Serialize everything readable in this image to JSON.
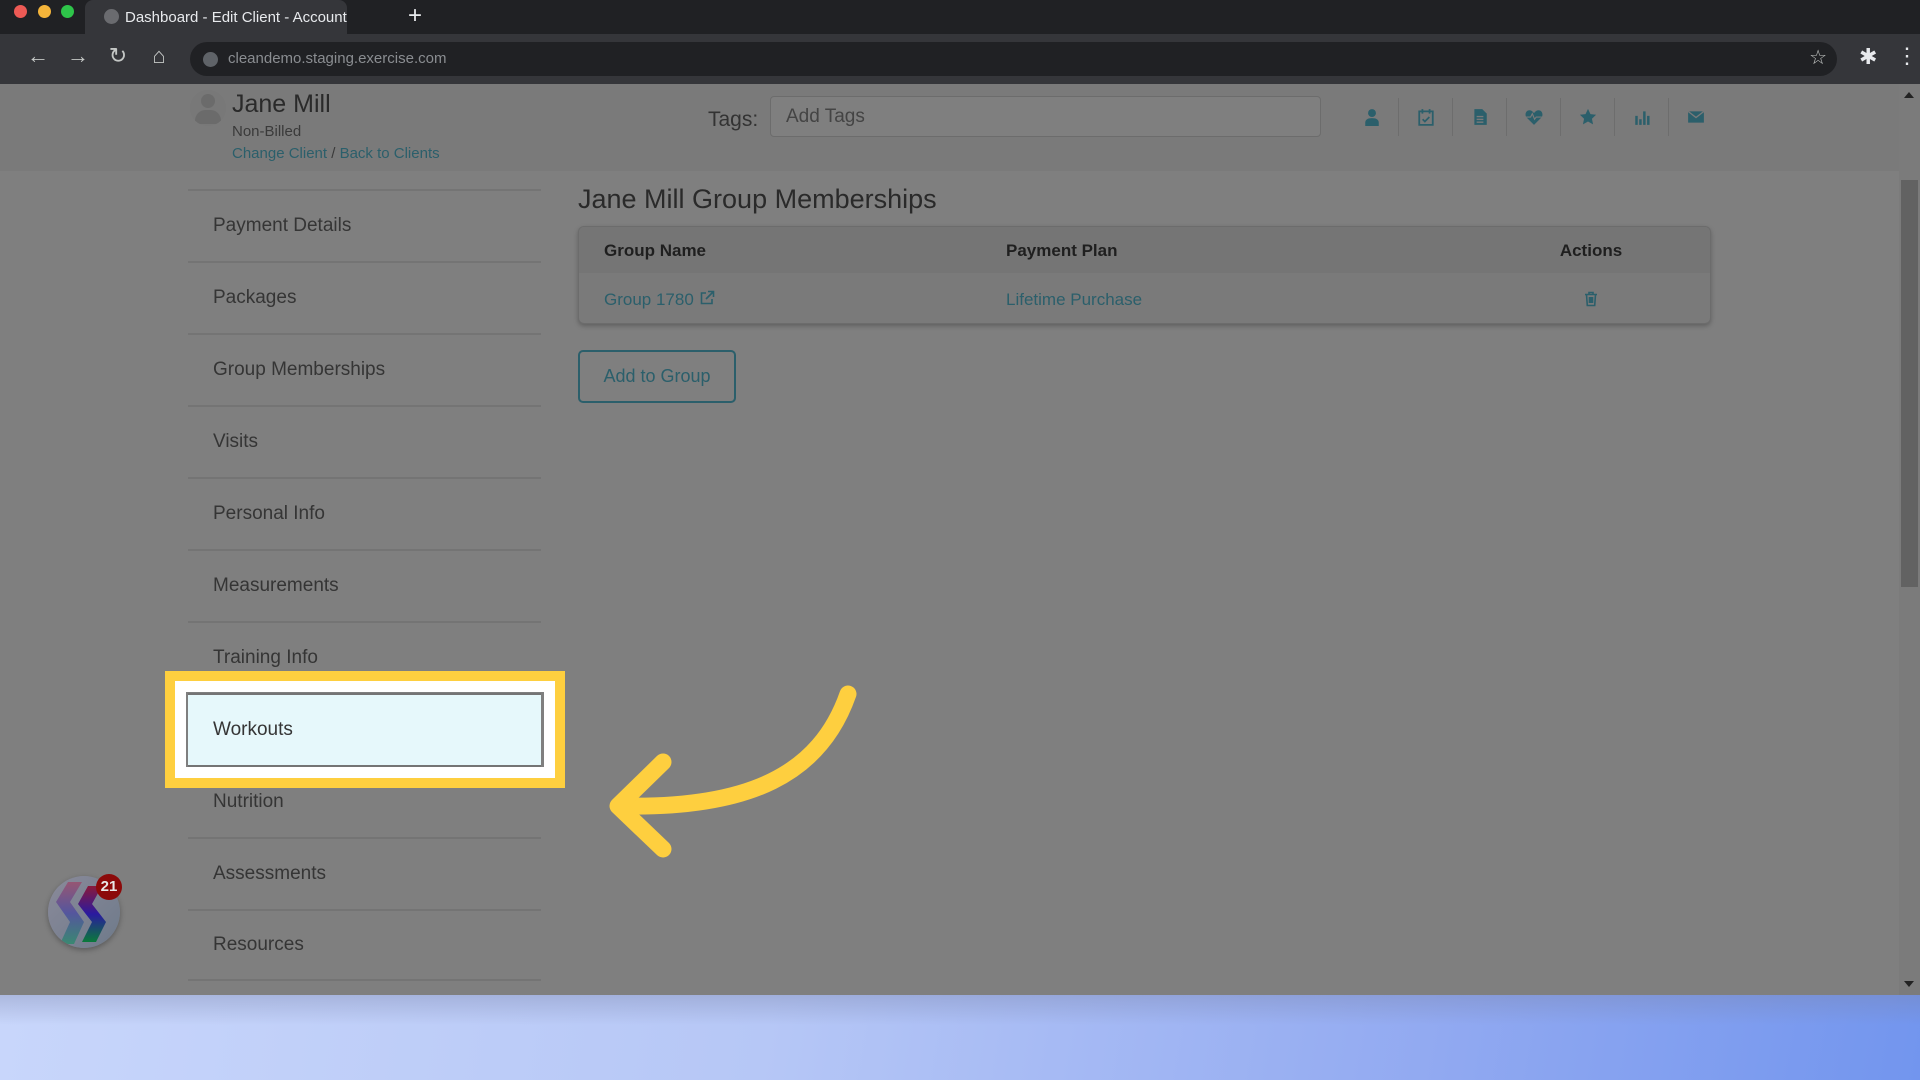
{
  "browser": {
    "tab_title": "Dashboard - Edit Client - Account",
    "new_tab_label": "+",
    "url": "cleandemo.staging.exercise.com"
  },
  "client": {
    "name": "Jane Mill",
    "status": "Non-Billed",
    "change_client_label": "Change Client",
    "separator": "/",
    "back_label": "Back to Clients"
  },
  "tags": {
    "label": "Tags:",
    "placeholder": "Add Tags",
    "value": ""
  },
  "toolbar_icons": [
    "user-icon",
    "calendar-check-icon",
    "document-icon",
    "heartbeat-icon",
    "star-icon",
    "bar-chart-icon",
    "envelope-icon"
  ],
  "sidebar": {
    "items": [
      {
        "label": "Payment Details",
        "active": false
      },
      {
        "label": "Packages",
        "active": false
      },
      {
        "label": "Group Memberships",
        "active": false
      },
      {
        "label": "Visits",
        "active": false
      },
      {
        "label": "Personal Info",
        "active": false
      },
      {
        "label": "Measurements",
        "active": false
      },
      {
        "label": "Training Info",
        "active": false
      },
      {
        "label": "Workouts",
        "active": true
      },
      {
        "label": "Nutrition",
        "active": false
      },
      {
        "label": "Assessments",
        "active": false
      },
      {
        "label": "Resources",
        "active": false
      }
    ]
  },
  "main": {
    "title": "Jane Mill Group Memberships",
    "table": {
      "headers": [
        "Group Name",
        "Payment Plan",
        "Actions"
      ],
      "rows": [
        {
          "group_name": "Group 1780",
          "payment_plan": "Lifetime Purchase",
          "action": "delete"
        }
      ]
    },
    "add_button_label": "Add to Group"
  },
  "chat_widget": {
    "badge_count": "21"
  },
  "annotation": {
    "highlight_target": "Workouts",
    "highlight_color": "#fecf3f"
  },
  "colors": {
    "accent": "#2b5f6b",
    "active_item_bg": "#e6f8fb",
    "overlay_gray": "#7f7f7f"
  }
}
